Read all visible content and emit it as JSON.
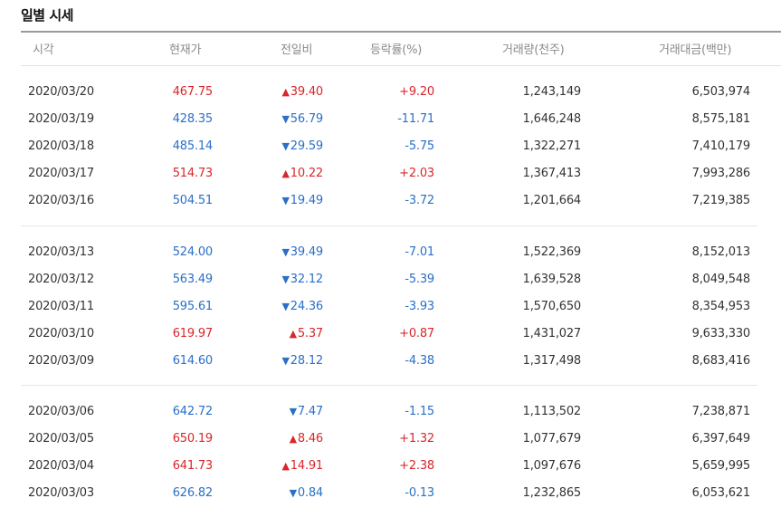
{
  "title": "일별 시세",
  "headers": {
    "date": "시각",
    "price": "현재가",
    "change": "전일비",
    "rate": "등락률(%)",
    "volume": "거래량(천주)",
    "amount": "거래대금(백만)"
  },
  "colors": {
    "up": "#d9262b",
    "down": "#2a6fc8"
  },
  "icons": {
    "up": "triangle-up-icon",
    "down": "triangle-down-icon"
  },
  "rows": [
    {
      "date": "2020/03/20",
      "price": "467.75",
      "arrow": "▲",
      "dir": "up",
      "change": "39.40",
      "rate": "+9.20",
      "volume": "1,243,149",
      "amount": "6,503,974"
    },
    {
      "date": "2020/03/19",
      "price": "428.35",
      "arrow": "▼",
      "dir": "down",
      "change": "56.79",
      "rate": "-11.71",
      "volume": "1,646,248",
      "amount": "8,575,181"
    },
    {
      "date": "2020/03/18",
      "price": "485.14",
      "arrow": "▼",
      "dir": "down",
      "change": "29.59",
      "rate": "-5.75",
      "volume": "1,322,271",
      "amount": "7,410,179"
    },
    {
      "date": "2020/03/17",
      "price": "514.73",
      "arrow": "▲",
      "dir": "up",
      "change": "10.22",
      "rate": "+2.03",
      "volume": "1,367,413",
      "amount": "7,993,286"
    },
    {
      "date": "2020/03/16",
      "price": "504.51",
      "arrow": "▼",
      "dir": "down",
      "change": "19.49",
      "rate": "-3.72",
      "volume": "1,201,664",
      "amount": "7,219,385"
    },
    {
      "date": "2020/03/13",
      "price": "524.00",
      "arrow": "▼",
      "dir": "down",
      "change": "39.49",
      "rate": "-7.01",
      "volume": "1,522,369",
      "amount": "8,152,013"
    },
    {
      "date": "2020/03/12",
      "price": "563.49",
      "arrow": "▼",
      "dir": "down",
      "change": "32.12",
      "rate": "-5.39",
      "volume": "1,639,528",
      "amount": "8,049,548"
    },
    {
      "date": "2020/03/11",
      "price": "595.61",
      "arrow": "▼",
      "dir": "down",
      "change": "24.36",
      "rate": "-3.93",
      "volume": "1,570,650",
      "amount": "8,354,953"
    },
    {
      "date": "2020/03/10",
      "price": "619.97",
      "arrow": "▲",
      "dir": "up",
      "change": "5.37",
      "rate": "+0.87",
      "volume": "1,431,027",
      "amount": "9,633,330"
    },
    {
      "date": "2020/03/09",
      "price": "614.60",
      "arrow": "▼",
      "dir": "down",
      "change": "28.12",
      "rate": "-4.38",
      "volume": "1,317,498",
      "amount": "8,683,416"
    },
    {
      "date": "2020/03/06",
      "price": "642.72",
      "arrow": "▼",
      "dir": "down",
      "change": "7.47",
      "rate": "-1.15",
      "volume": "1,113,502",
      "amount": "7,238,871"
    },
    {
      "date": "2020/03/05",
      "price": "650.19",
      "arrow": "▲",
      "dir": "up",
      "change": "8.46",
      "rate": "+1.32",
      "volume": "1,077,679",
      "amount": "6,397,649"
    },
    {
      "date": "2020/03/04",
      "price": "641.73",
      "arrow": "▲",
      "dir": "up",
      "change": "14.91",
      "rate": "+2.38",
      "volume": "1,097,676",
      "amount": "5,659,995"
    },
    {
      "date": "2020/03/03",
      "price": "626.82",
      "arrow": "▼",
      "dir": "down",
      "change": "0.84",
      "rate": "-0.13",
      "volume": "1,232,865",
      "amount": "6,053,621"
    }
  ]
}
